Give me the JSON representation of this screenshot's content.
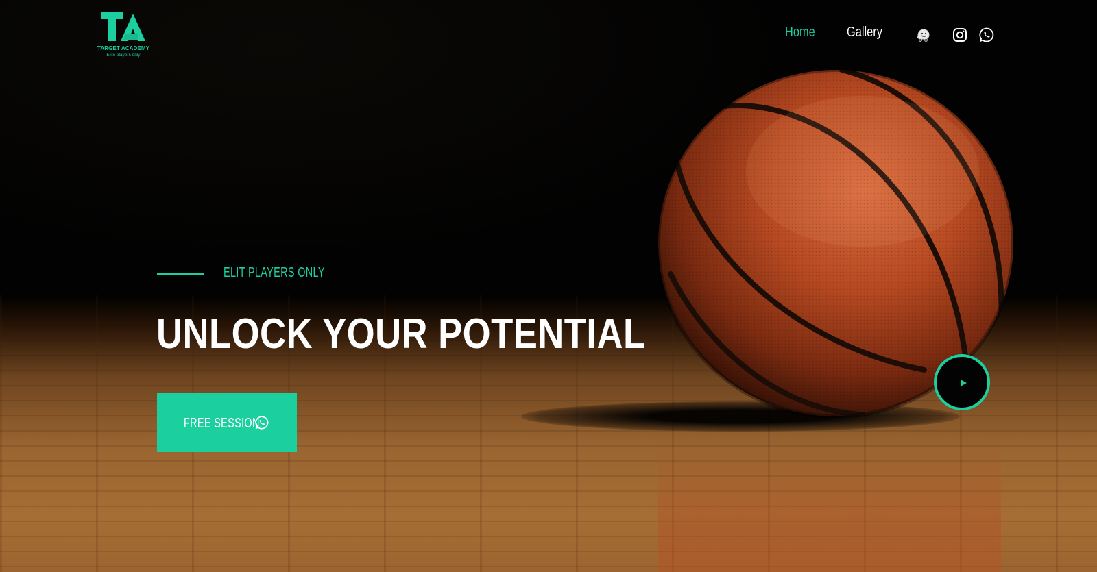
{
  "brand": {
    "name": "TARGET ACADEMY",
    "tagline": "Elite players only",
    "accent_color": "#1ccf9f",
    "logo_icon": "ta-monogram-icon"
  },
  "nav": {
    "items": [
      {
        "label": "Home",
        "active": true
      },
      {
        "label": "Gallery",
        "active": false
      }
    ],
    "social": [
      {
        "icon": "waze-icon"
      },
      {
        "icon": "instagram-icon"
      },
      {
        "icon": "whatsapp-icon"
      }
    ]
  },
  "hero": {
    "eyebrow": "ELIT PLAYERS ONLY",
    "headline": "UNLOCK YOUR POTENTIAL",
    "cta_label": "FREE SESSION",
    "cta_icon": "whatsapp-icon",
    "play_icon": "play-icon",
    "background": "basketball-on-court-image"
  }
}
